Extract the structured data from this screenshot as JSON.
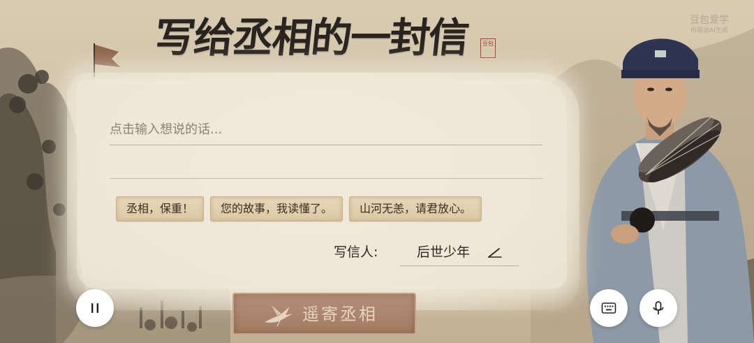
{
  "header": {
    "title": "写给丞相的一封信",
    "seal_text": "豆包",
    "watermark_main": "豆包爱学",
    "watermark_sub": "内容由AI生成"
  },
  "letter": {
    "input_placeholder": "点击输入想说的话...",
    "suggestions": [
      "丞相，保重！",
      "您的故事，我读懂了。",
      "山河无恙，请君放心。"
    ],
    "writer_label": "写信人:",
    "writer_value": "后世少年"
  },
  "actions": {
    "send_label": "遥寄丞相"
  },
  "icons": {
    "pause": "pause-icon",
    "keyboard": "keyboard-icon",
    "mic": "microphone-icon",
    "edit": "pencil-icon",
    "send": "crane-icon"
  },
  "colors": {
    "paper": "#efe7d6",
    "chip": "#e1d0ae",
    "send_button": "#a98268",
    "seal": "#b23a2e",
    "title": "#2a2420"
  }
}
